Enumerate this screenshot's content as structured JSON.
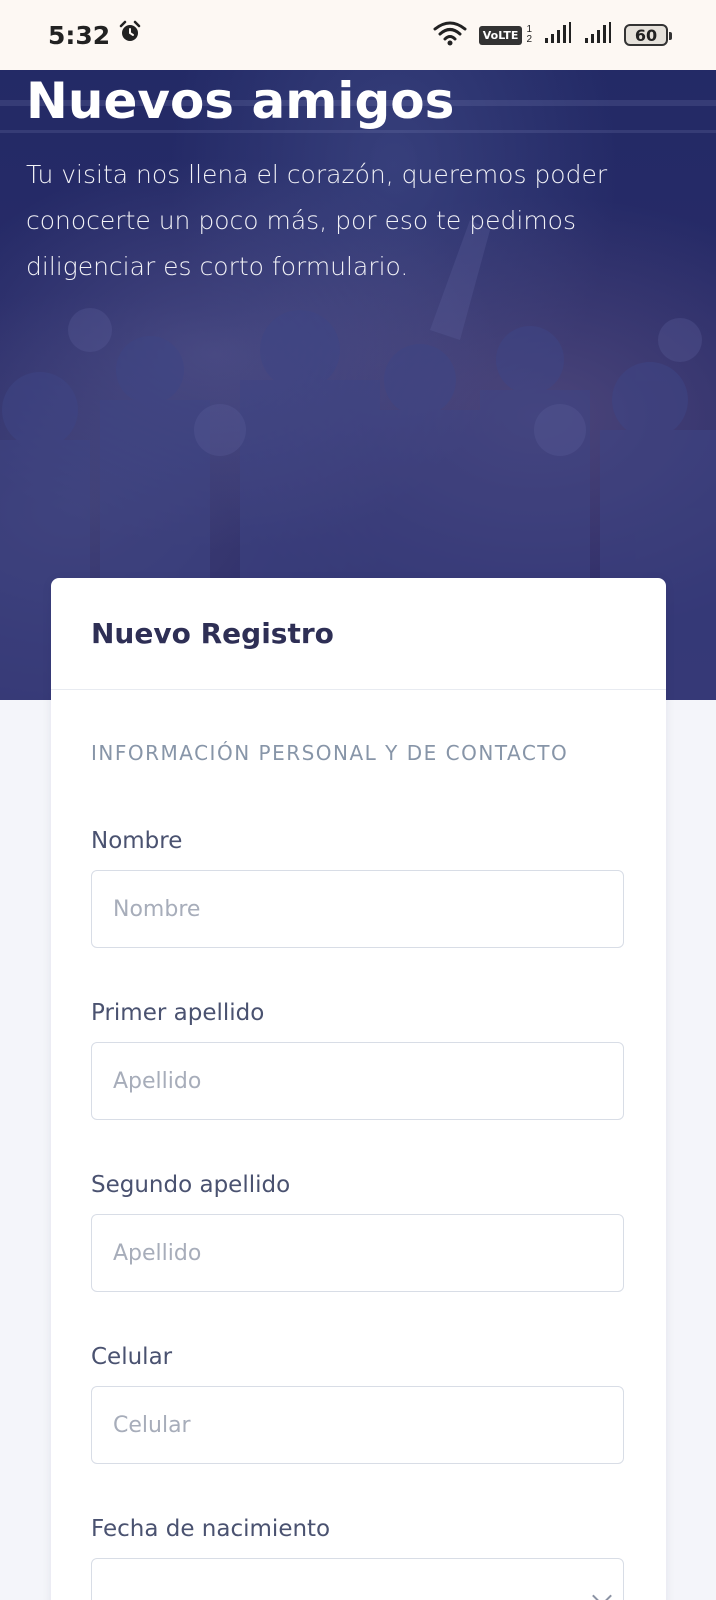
{
  "status_bar": {
    "time": "5:32",
    "volte": "VoLTE",
    "sim_numbers": [
      "1",
      "2"
    ],
    "battery": "60"
  },
  "hero": {
    "title": "Nuevos amigos",
    "description": "Tu visita nos llena el corazón, queremos poder conocerte un poco más, por eso te pedimos diligenciar es corto formulario."
  },
  "card": {
    "title": "Nuevo Registro",
    "section_title": "INFORMACIÓN PERSONAL Y DE CONTACTO",
    "fields": [
      {
        "label": "Nombre",
        "placeholder": "Nombre",
        "value": ""
      },
      {
        "label": "Primer apellido",
        "placeholder": "Apellido",
        "value": ""
      },
      {
        "label": "Segundo apellido",
        "placeholder": "Apellido",
        "value": ""
      },
      {
        "label": "Celular",
        "placeholder": "Celular",
        "value": ""
      },
      {
        "label": "Fecha de nacimiento",
        "placeholder": "",
        "value": ""
      }
    ]
  },
  "colors": {
    "hero_overlay": "#262a66",
    "card_title": "#2e2f55",
    "label": "#4a5270",
    "section": "#8795a8",
    "page_bg": "#f4f5fa"
  }
}
